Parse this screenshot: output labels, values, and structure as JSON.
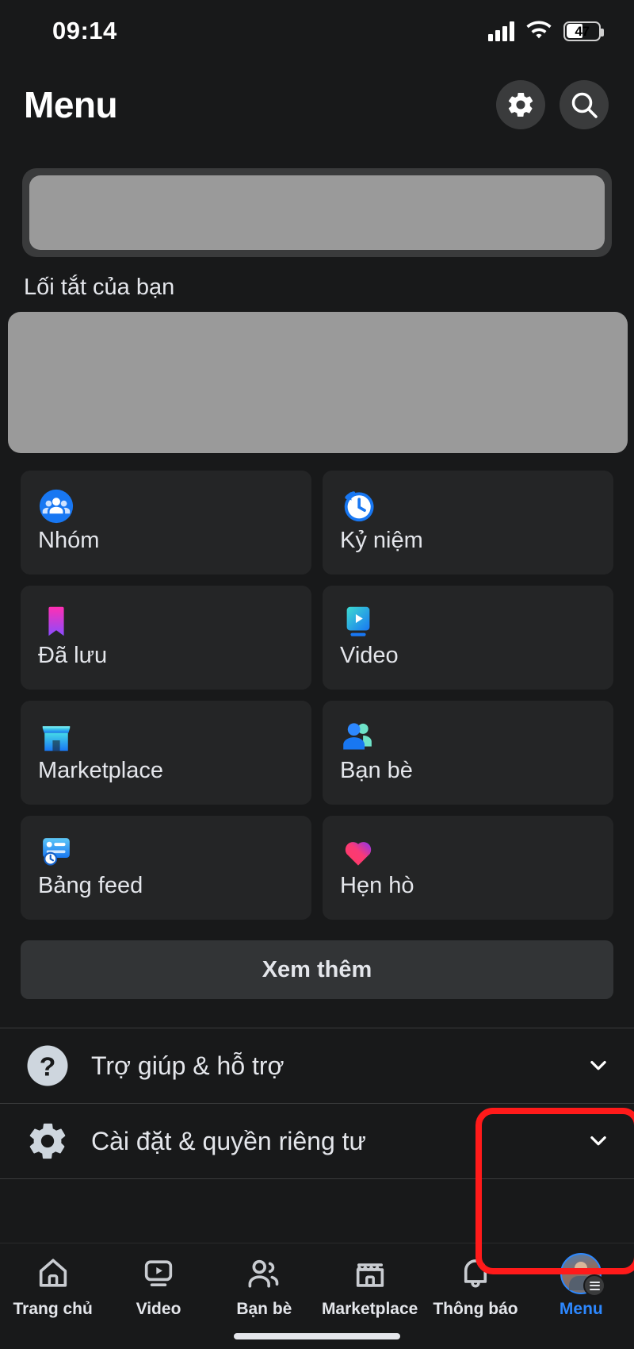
{
  "status_bar": {
    "time": "09:14",
    "signal_icon": "cellular-signal-icon",
    "wifi_icon": "wifi-icon",
    "battery_percent": "47",
    "battery_level": 47
  },
  "header": {
    "title": "Menu",
    "settings_icon": "gear-icon",
    "search_icon": "search-icon"
  },
  "placeholders": {
    "search_skeleton": "search-bar-placeholder",
    "shortcuts_skeleton": "shortcuts-placeholder"
  },
  "shortcuts_section": {
    "label": "Lối tắt của bạn"
  },
  "menu_grid": {
    "tiles": [
      {
        "label": "Nhóm",
        "icon": "groups-icon"
      },
      {
        "label": "Kỷ niệm",
        "icon": "memories-clock-icon"
      },
      {
        "label": "Đã lưu",
        "icon": "saved-bookmark-icon"
      },
      {
        "label": "Video",
        "icon": "video-icon"
      },
      {
        "label": "Marketplace",
        "icon": "marketplace-storefront-icon"
      },
      {
        "label": "Bạn bè",
        "icon": "friends-icon"
      },
      {
        "label": "Bảng feed",
        "icon": "feeds-icon"
      },
      {
        "label": "Hẹn hò",
        "icon": "dating-heart-icon"
      }
    ],
    "see_more_label": "Xem thêm"
  },
  "list_rows": [
    {
      "label": "Trợ giúp & hỗ trợ",
      "icon": "help-question-icon",
      "chevron": "chevron-down-icon"
    },
    {
      "label": "Cài đặt & quyền riêng tư",
      "icon": "settings-gear-icon",
      "chevron": "chevron-down-icon"
    }
  ],
  "bottom_nav": {
    "items": [
      {
        "label": "Trang chủ",
        "icon": "home-icon",
        "active": false
      },
      {
        "label": "Video",
        "icon": "video-play-icon",
        "active": false
      },
      {
        "label": "Bạn bè",
        "icon": "friends-people-icon",
        "active": false
      },
      {
        "label": "Marketplace",
        "icon": "storefront-icon",
        "active": false
      },
      {
        "label": "Thông báo",
        "icon": "bell-icon",
        "active": false
      },
      {
        "label": "Menu",
        "icon": "profile-avatar-menu-icon",
        "active": true
      }
    ],
    "active_color": "#2d88ff"
  },
  "annotation": {
    "shape": "rounded-rectangle",
    "color": "#ff1a1a",
    "target": "menu-tab"
  }
}
